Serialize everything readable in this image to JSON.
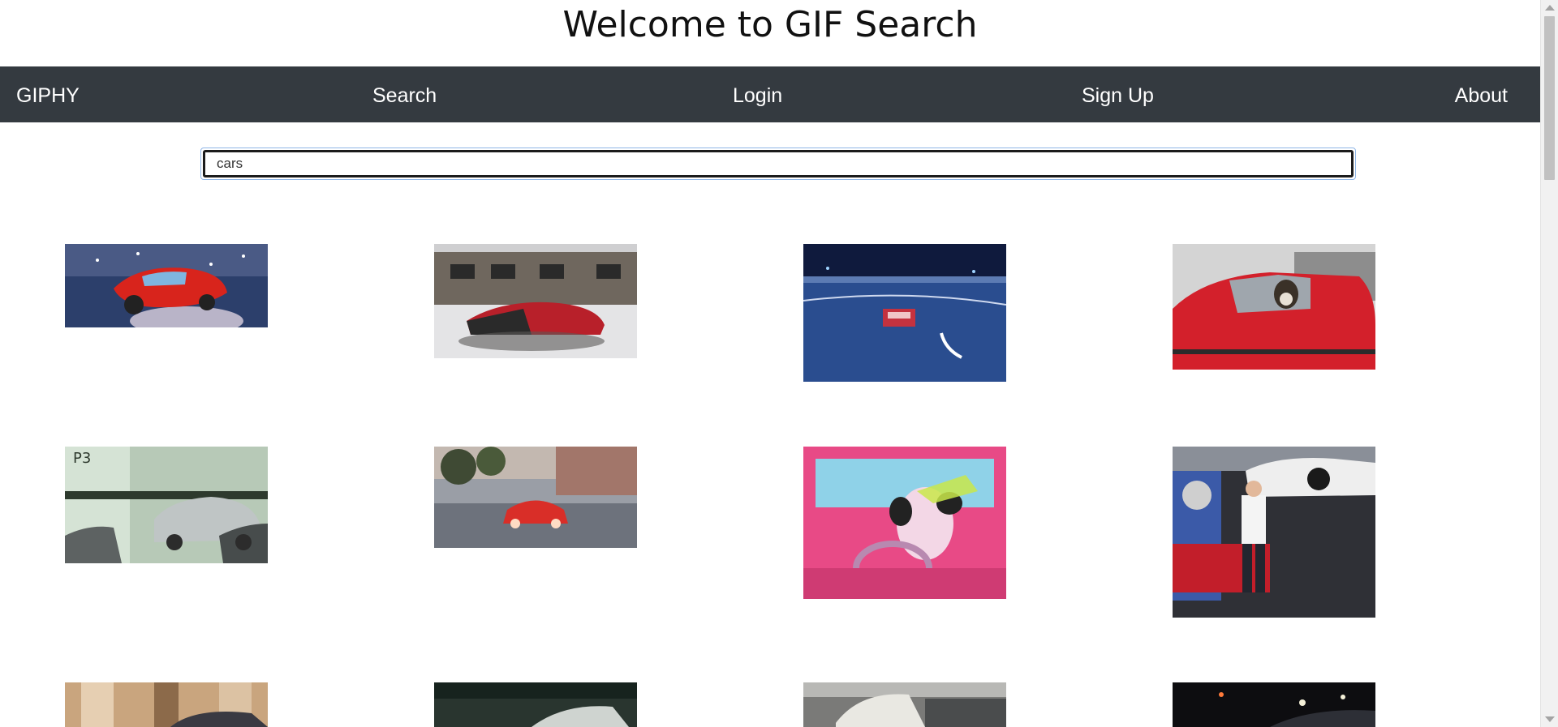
{
  "page": {
    "title": "Welcome to GIF Search"
  },
  "nav": {
    "brand": "GIPHY",
    "search": "Search",
    "login": "Login",
    "signup": "Sign Up",
    "about": "About"
  },
  "search": {
    "value": "cars",
    "placeholder": ""
  },
  "results": [
    {
      "subject": "red cartoon race car in stadium"
    },
    {
      "subject": "red car drifting in snow"
    },
    {
      "subject": "red car driving on night highway"
    },
    {
      "subject": "dog driving red car"
    },
    {
      "subject": "cars in parking garage P3"
    },
    {
      "subject": "red sports car on city street"
    },
    {
      "subject": "cartoon dog driving pink car"
    },
    {
      "subject": "mechanic under lifted white car"
    },
    {
      "subject": "car in ornate building"
    },
    {
      "subject": "dark street with cars"
    },
    {
      "subject": "car crash on street"
    },
    {
      "subject": "cars at night"
    }
  ],
  "colors": {
    "navbar": "#343a40",
    "nav_text": "#ffffff",
    "focus_ring": "#8fb5e6"
  }
}
